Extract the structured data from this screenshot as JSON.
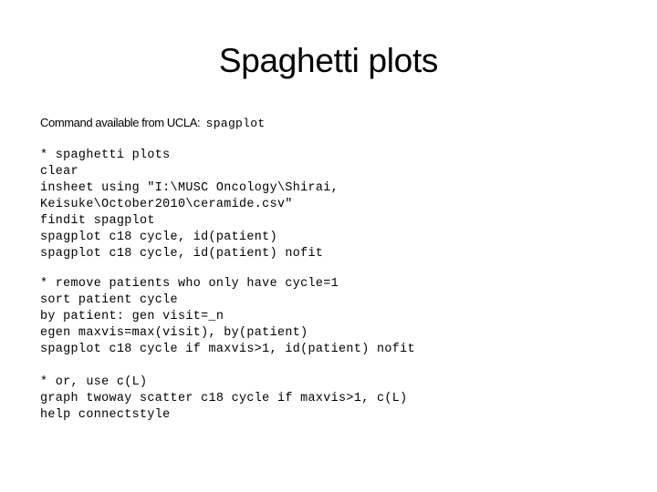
{
  "slide": {
    "title": "Spaghetti plots",
    "intro_label": "Command available from UCLA:",
    "intro_command": "spagplot"
  },
  "code_blocks": [
    {
      "lines": [
        "* spaghetti plots",
        "clear",
        "insheet using \"I:\\MUSC Oncology\\Shirai,",
        "Keisuke\\October2010\\ceramide.csv\"",
        "findit spagplot",
        "spagplot c18 cycle, id(patient)",
        "spagplot c18 cycle, id(patient) nofit"
      ]
    },
    {
      "lines": [
        "* remove patients who only have cycle=1",
        "sort patient cycle",
        "by patient: gen visit=_n",
        "egen maxvis=max(visit), by(patient)",
        "spagplot c18 cycle if maxvis>1, id(patient) nofit"
      ]
    },
    {
      "lines": [
        "* or, use c(L)",
        "graph twoway scatter c18 cycle if maxvis>1, c(L)",
        "help connectstyle"
      ]
    }
  ]
}
